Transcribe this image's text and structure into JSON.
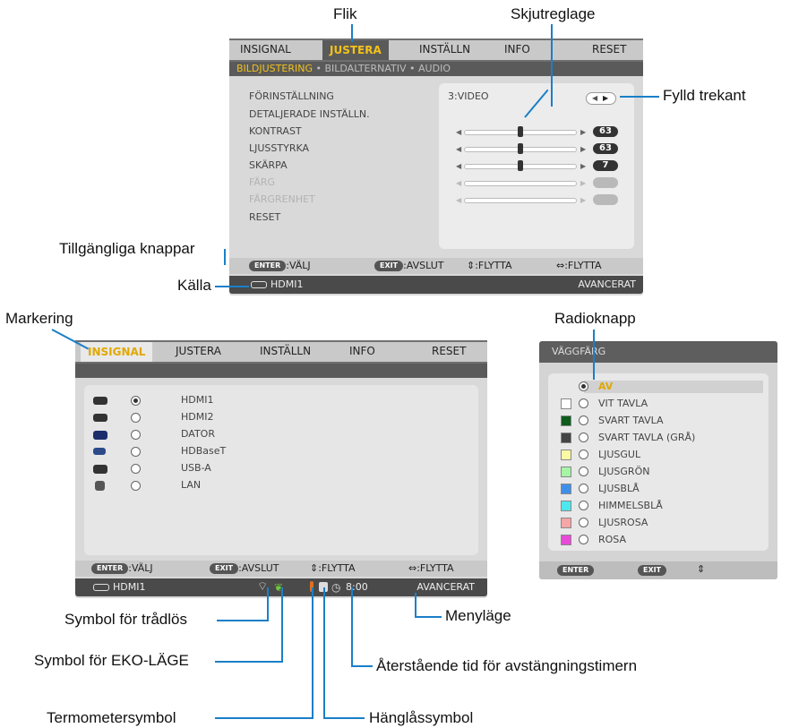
{
  "callouts": {
    "flik": "Flik",
    "skjutreglage": "Skjutreglage",
    "fylld_trekant": "Fylld trekant",
    "tillgangliga_knappar": "Tillgängliga knappar",
    "kalla": "Källa",
    "markering": "Markering",
    "radioknapp": "Radioknapp",
    "tradlos": "Symbol för trådlös",
    "eko": "Symbol för EKO-LÄGE",
    "termometer": "Termometersymbol",
    "menylage": "Menyläge",
    "aterstaende": "Återstående tid för avstängningstimern",
    "hanglas": "Hänglåssymbol"
  },
  "tabs": [
    "INSIGNAL",
    "JUSTERA",
    "INSTÄLLN",
    "INFO",
    "RESET"
  ],
  "top_menu": {
    "sub_active": "BILDJUSTERING",
    "sub_sep": "•",
    "sub_2": "BILDALTERNATIV",
    "sub_3": "AUDIO",
    "items": [
      "FÖRINSTÄLLNING",
      "DETALJERADE INSTÄLLN.",
      "KONTRAST",
      "LJUSSTYRKA",
      "SKÄRPA",
      "FÄRG",
      "FÄRGRENHET",
      "RESET"
    ],
    "preset_value": "3:VIDEO",
    "kontrast": 63,
    "ljusstyrka": 63,
    "skarpa": 7,
    "footer_enter": "ENTER",
    "footer_valj": ":VÄLJ",
    "footer_exit": "EXIT",
    "footer_avslut": ":AVSLUT",
    "footer_flytta1": "⇕:FLYTTA",
    "footer_flytta2": "⇔:FLYTTA",
    "source": "HDMI1",
    "mode": "AVANCERAT"
  },
  "bottom_menu": {
    "sources": [
      "HDMI1",
      "HDMI2",
      "DATOR",
      "HDBaseT",
      "USB-A",
      "LAN"
    ],
    "selected_index": 0,
    "source": "HDMI1",
    "timer": "8:00",
    "mode": "AVANCERAT"
  },
  "wall_menu": {
    "title": "VÄGGFÄRG",
    "items": [
      "AV",
      "VIT TAVLA",
      "SVART TAVLA",
      "SVART TAVLA (GRÅ)",
      "LJUSGUL",
      "LJUSGRÖN",
      "LJUSBLÅ",
      "HIMMELSBLÅ",
      "LJUSROSA",
      "ROSA"
    ],
    "swatch_colors": [
      "",
      "#ffffff",
      "#0d5c1c",
      "#444444",
      "#fbf9a4",
      "#a6f5a6",
      "#3f8fe9",
      "#4de8ee",
      "#f6a6a6",
      "#e84ad8"
    ],
    "footer_enter": "ENTER",
    "footer_exit": "EXIT",
    "footer_arrow": "⇕"
  },
  "colors": {
    "callout_line": "#1a7fc8",
    "highlight": "#f3c21a"
  }
}
